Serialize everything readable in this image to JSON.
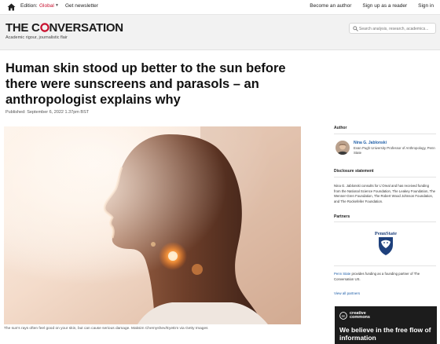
{
  "topbar": {
    "home_icon": "home-icon",
    "edition_label": "Edition:",
    "edition_value": "Global",
    "get_newsletter": "Get newsletter",
    "become_author": "Become an author",
    "sign_up_reader": "Sign up as a reader",
    "sign_in": "Sign in"
  },
  "masthead": {
    "logo_prefix": "THE C",
    "logo_suffix": "NVERSATION",
    "tagline": "Academic rigour, journalistic flair",
    "search_placeholder": "Search analysis, research, academics...",
    "search_icon": "search-icon"
  },
  "article": {
    "headline": "Human skin stood up better to the sun before there were sunscreens and parasols – an anthropologist explains why",
    "published": "Published: September 6, 2022 1.37pm BST",
    "image_caption": "The sun's rays often feel good on your skin, but can cause serious damage. Maksim Chernyshev/EyeEm via Getty Images"
  },
  "sidebar": {
    "author_title": "Author",
    "author_name": "Nina G. Jablonski",
    "author_role": "Evan Pugh University Professor of Anthropology, Penn State",
    "disclosure_title": "Disclosure statement",
    "disclosure_text": "Nina G. Jablonski consults for L'Oreal and has received funding from the National Science Foundation, The Leakey Foundation, The Wenner-Gren Foundation, The Robert Wood Johnson Foundation, and The Rockefeller Foundation.",
    "partners_title": "Partners",
    "partner_logo_text": "PennState",
    "funding_link": "Penn State",
    "funding_text": " provides funding as a founding partner of The Conversation US.",
    "all_partners": "View all partners"
  },
  "cc": {
    "brand_line1": "creative",
    "brand_line2": "commons",
    "text": "We believe in the free flow of information"
  },
  "colors": {
    "accent": "#c8102e",
    "link": "#1f5fa8",
    "masthead_bg": "#f2f2f2",
    "cc_bg": "#1c1c1c"
  }
}
